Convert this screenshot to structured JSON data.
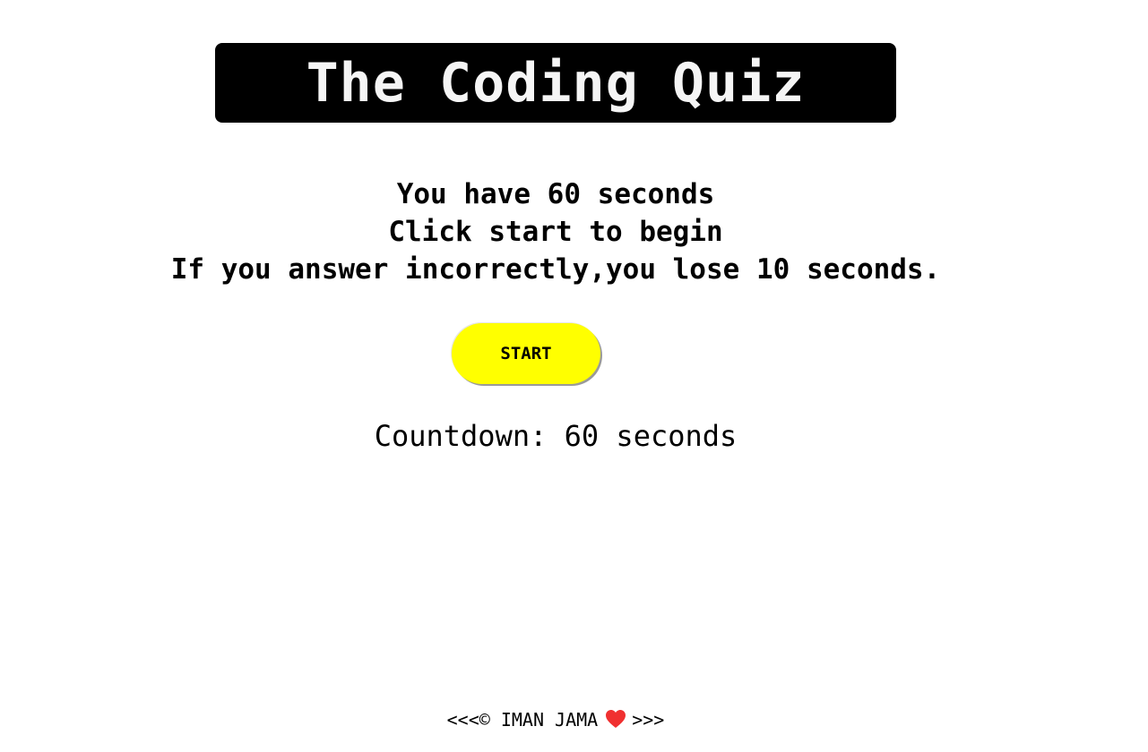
{
  "header": {
    "title": "The Coding Quiz"
  },
  "instructions": {
    "line1": "You have 60 seconds",
    "line2": "Click start to begin",
    "line3": "If you answer incorrectly,you lose 10 seconds."
  },
  "controls": {
    "start_label": "START"
  },
  "countdown": {
    "text": "Countdown: 60 seconds"
  },
  "footer": {
    "prefix": "<<<© IMAN JAMA",
    "suffix": ">>>",
    "heart_icon": "heart-icon",
    "heart_color": "#f03030"
  },
  "colors": {
    "title_bg": "#000000",
    "title_text": "#f5f5f5",
    "start_bg": "#ffff00"
  }
}
